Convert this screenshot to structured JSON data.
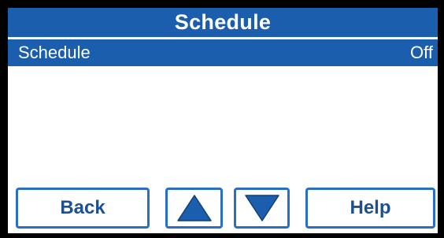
{
  "header": {
    "title": "Schedule"
  },
  "menu": {
    "rows": [
      {
        "label": "Schedule",
        "value": "Off"
      }
    ]
  },
  "buttons": {
    "back_label": "Back",
    "up_icon": "arrow-up-icon",
    "down_icon": "arrow-down-icon",
    "help_label": "Help"
  },
  "colors": {
    "accent": "#1b5eae",
    "button_border": "#2b6fc4",
    "button_text": "#1d4f91",
    "background": "#ffffff",
    "bezel": "#000000"
  }
}
